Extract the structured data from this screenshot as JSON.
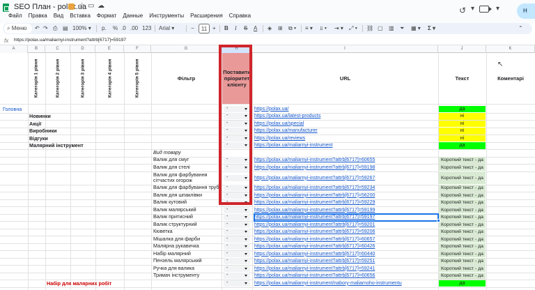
{
  "doc": {
    "title": "SEO План - polax.ua",
    "menu": [
      "Файл",
      "Правка",
      "Вид",
      "Вставка",
      "Формат",
      "Данные",
      "Инструменты",
      "Расширения",
      "Справка"
    ],
    "share_initial": "Н"
  },
  "toolbar": {
    "search_label": "Меню",
    "zoom": "100%",
    "currency": "р.",
    "percent": "%",
    "dec_less": ".0",
    "dec_more": ".00",
    "num_format": "123",
    "font": "Arial",
    "font_size": "11"
  },
  "formula_bar": {
    "fx_label": "fx",
    "content": "https://polax.ua/maliarnyi-instrument?attrb[6717]=59197"
  },
  "columns": [
    "A",
    "B",
    "C",
    "D",
    "E",
    "F",
    "G",
    "H",
    "I",
    "J",
    "K"
  ],
  "headers": {
    "cat1": "Категорія 1 рівня",
    "cat2": "Категорія 2 рівня",
    "cat3": "Категорія 3 рівня",
    "cat4": "Категорія 4 рівня",
    "cat5": "Категорія 5 рівня",
    "filter": "Фільтр",
    "priority": "Поставити пріоритет клієнту",
    "url": "URL",
    "text": "Текст",
    "comments": "Коментарі"
  },
  "rows": [
    {
      "a": "Головна",
      "b": "",
      "g": "",
      "dd": "-",
      "url": "https://polax.ua/",
      "text": "да",
      "text_status": "green"
    },
    {
      "a": "",
      "b": "Новинки",
      "g": "",
      "dd": "-",
      "url": "https://polax.ua/latest-products",
      "text": "ні",
      "text_status": "yellow"
    },
    {
      "a": "",
      "b": "Акції",
      "g": "",
      "dd": "-",
      "url": "https://polax.ua/special",
      "text": "ні",
      "text_status": "yellow"
    },
    {
      "a": "",
      "b": "Виробники",
      "g": "",
      "dd": "-",
      "url": "https://polax.ua/manufacturer",
      "text": "ні",
      "text_status": "yellow"
    },
    {
      "a": "",
      "b": "Відгуки",
      "g": "",
      "dd": "-",
      "url": "https://polax.ua/reviews",
      "text": "ні",
      "text_status": "yellow"
    },
    {
      "a": "",
      "b": "Малярний інструмент",
      "g": "",
      "dd": "-",
      "url": "https://polax.ua/maliarnyi-instrument",
      "text": "да",
      "text_status": "green"
    },
    {
      "a": "",
      "b": "",
      "g": "Вид товару",
      "g_italic": true,
      "dd": "",
      "url": "",
      "text": "",
      "text_status": "none"
    },
    {
      "a": "",
      "b": "",
      "g": "Валик для смуг",
      "dd": "-",
      "url": "https://polax.ua/maliarnyi-instrument?attrb[6717]=60655",
      "text": "Короткий текст - да",
      "text_status": "light"
    },
    {
      "a": "",
      "b": "",
      "g": "Валик для стелі",
      "dd": "-",
      "url": "https://polax.ua/maliarnyi-instrument?attrb[6717]=59198",
      "text": "Короткий текст - да",
      "text_status": "light"
    },
    {
      "a": "",
      "b": "",
      "g": "Валик для фарбування\nсітчастих огорож",
      "dd": "-",
      "url": "https://polax.ua/maliarnyi-instrument?attrb[6717]=59267",
      "text": "Короткий текст - да",
      "text_status": "light",
      "tall": true
    },
    {
      "a": "",
      "b": "",
      "g": "Валик для фарбування труб",
      "dd": "-",
      "url": "https://polax.ua/maliarnyi-instrument?attrb[6717]=59234",
      "text": "Короткий текст - да",
      "text_status": "light"
    },
    {
      "a": "",
      "b": "",
      "g": "Валик для шпаклівки",
      "dd": "-",
      "url": "https://polax.ua/maliarnyi-instrument?attrb[6717]=56200",
      "text": "Короткий текст - да",
      "text_status": "light"
    },
    {
      "a": "",
      "b": "",
      "g": "Валик кутовий",
      "dd": "-",
      "url": "https://polax.ua/maliarnyi-instrument?attrb[6717]=59229",
      "text": "Короткий текст - да",
      "text_status": "light"
    },
    {
      "a": "",
      "b": "",
      "g": "Валик малярський",
      "dd": "-",
      "url": "https://polax.ua/maliarnyi-instrument?attrb[6717]=59199",
      "text": "Короткий текст - да",
      "text_status": "light"
    },
    {
      "a": "",
      "b": "",
      "g": "Валик притисний",
      "dd": "-",
      "url": "https://polax.ua/maliarnyi-instrument?attrb[6717]=59197",
      "text": "Короткий текст - да",
      "text_status": "light",
      "selected": true
    },
    {
      "a": "",
      "b": "",
      "g": "Валик структурний",
      "dd": "-",
      "url": "https://polax.ua/maliarnyi-instrument?attrb[6717]=59201",
      "text": "Короткий текст - да",
      "text_status": "light"
    },
    {
      "a": "",
      "b": "",
      "g": "Кюветка",
      "dd": "-",
      "url": "https://polax.ua/maliarnyi-instrument?attrb[6717]=59206",
      "text": "Короткий текст - да",
      "text_status": "light"
    },
    {
      "a": "",
      "b": "",
      "g": "Мішалка для фарби",
      "dd": "-",
      "url": "https://polax.ua/maliarnyi-instrument?attrb[6717]=60657",
      "text": "Короткий текст - да",
      "text_status": "light"
    },
    {
      "a": "",
      "b": "",
      "g": "Малярна рукавичка",
      "dd": "-",
      "url": "https://polax.ua/maliarnyi-instrument?attrb[6717]=60426",
      "text": "Короткий текст - да",
      "text_status": "light"
    },
    {
      "a": "",
      "b": "",
      "g": "Набір малярний",
      "dd": "-",
      "url": "https://polax.ua/maliarnyi-instrument?attrb[6717]=60440",
      "text": "Короткий текст - да",
      "text_status": "light"
    },
    {
      "a": "",
      "b": "",
      "g": "Пензель малярський",
      "dd": "-",
      "url": "https://polax.ua/maliarnyi-instrument?attrb[6717]=59251",
      "text": "Короткий текст - да",
      "text_status": "light"
    },
    {
      "a": "",
      "b": "",
      "g": "Ручка для валика",
      "dd": "-",
      "url": "https://polax.ua/maliarnyi-instrument?attrb[6717]=59241",
      "text": "Короткий текст - да",
      "text_status": "light"
    },
    {
      "a": "",
      "b": "",
      "g": "Тримач інструменту",
      "dd": "-",
      "url": "https://polax.ua/maliarnyi-instrument?attrb[6717]=60656",
      "text": "Короткий текст - да",
      "text_status": "light"
    },
    {
      "a": "",
      "c": "Набір для малярних робіт",
      "g": "",
      "dd": "-",
      "url": "https://polax.ua/maliarnyi-instrument/nabory-maliarnoho-instrumentu",
      "text": "да",
      "text_status": "green"
    }
  ],
  "colors": {
    "green": "#00ff00",
    "yellow": "#ffff00",
    "light": "#d9ead3",
    "priority_header": "#ea9999",
    "highlight_box": "#d0252b",
    "selection": "#1a73e8",
    "section_a": "#1155cc",
    "section_c": "#cc0000"
  }
}
